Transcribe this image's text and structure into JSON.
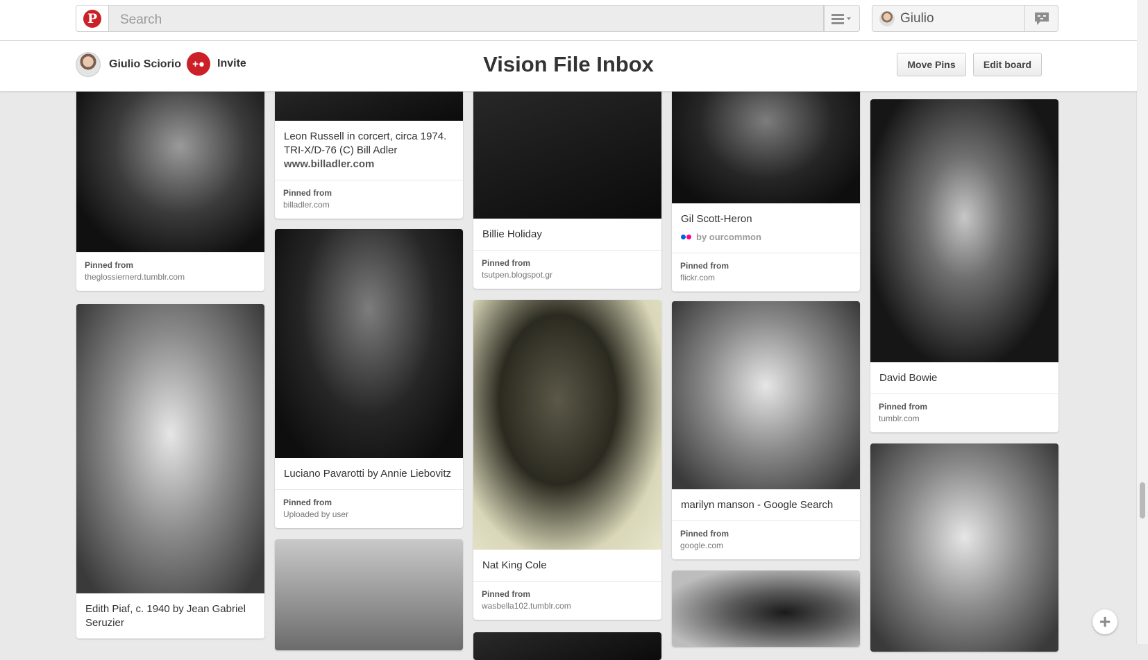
{
  "header": {
    "search_placeholder": "Search",
    "user_name": "Giulio"
  },
  "board": {
    "owner_name": "Giulio Sciorio",
    "invite_label": "Invite",
    "title": "Vision File Inbox",
    "move_pins_label": "Move Pins",
    "edit_board_label": "Edit board"
  },
  "pins": [
    {
      "description": "",
      "pinned_from_label": "Pinned from",
      "source": "theglossiernerd.tumblr.com"
    },
    {
      "description": "Edith Piaf, c. 1940 by Jean Gabriel Seruzier"
    },
    {
      "description": "Leon Russell in corcert, circa 1974. TRI-X/D-76 (C) Bill Adler",
      "link": "www.billadler.com",
      "pinned_from_label": "Pinned from",
      "source": "billadler.com"
    },
    {
      "description": "Luciano Pavarotti by Annie Liebovitz",
      "pinned_from_label": "Pinned from",
      "source": "Uploaded by user"
    },
    {
      "description": "Billie Holiday",
      "pinned_from_label": "Pinned from",
      "source": "tsutpen.blogspot.gr"
    },
    {
      "description": "Nat King Cole",
      "pinned_from_label": "Pinned from",
      "source": "wasbella102.tumblr.com"
    },
    {
      "description": "Gil Scott-Heron",
      "attribution": "by ourcommon",
      "pinned_from_label": "Pinned from",
      "source": "flickr.com"
    },
    {
      "description": "marilyn manson - Google Search",
      "pinned_from_label": "Pinned from",
      "source": "google.com"
    },
    {
      "description": "David Bowie",
      "pinned_from_label": "Pinned from",
      "source": "tumblr.com"
    }
  ],
  "fab": {
    "add_icon": "plus-icon"
  },
  "colors": {
    "brand": "#cb2027",
    "background": "#e9e9e9"
  }
}
